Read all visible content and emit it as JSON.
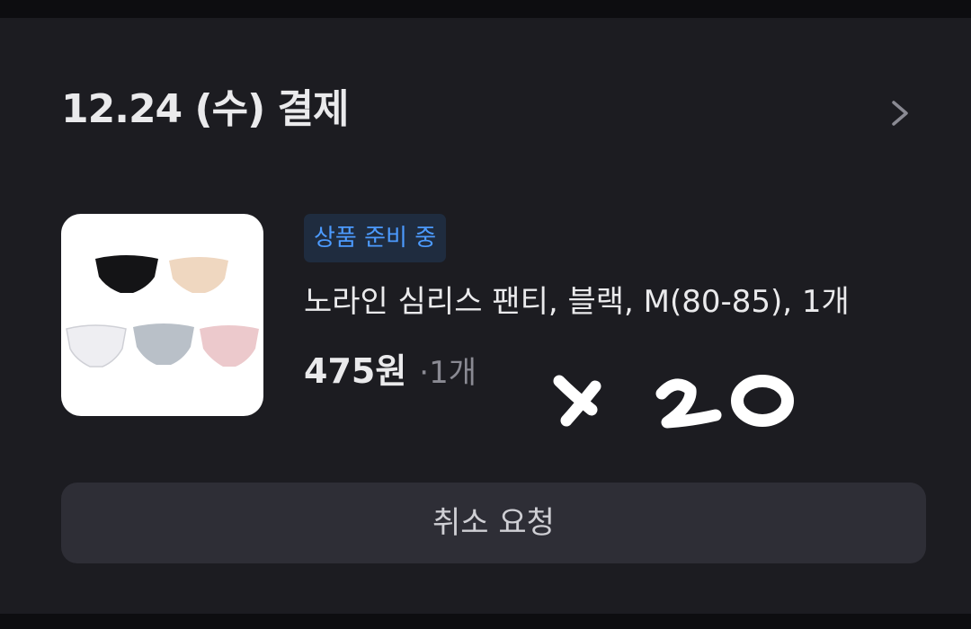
{
  "order": {
    "date_title": "12.24 (수) 결제",
    "chevron_icon": "chevron-right-icon"
  },
  "item": {
    "status": "상품 준비 중",
    "status_color": "#4c9bff",
    "name": "노라인 심리스 팬티, 블랙, M(80-85), 1개",
    "price": "475원",
    "separator": "·",
    "quantity": "1개",
    "image": "product-thumbnail"
  },
  "annotation": {
    "handwritten_text": "x20"
  },
  "actions": {
    "cancel_label": "취소 요청"
  }
}
